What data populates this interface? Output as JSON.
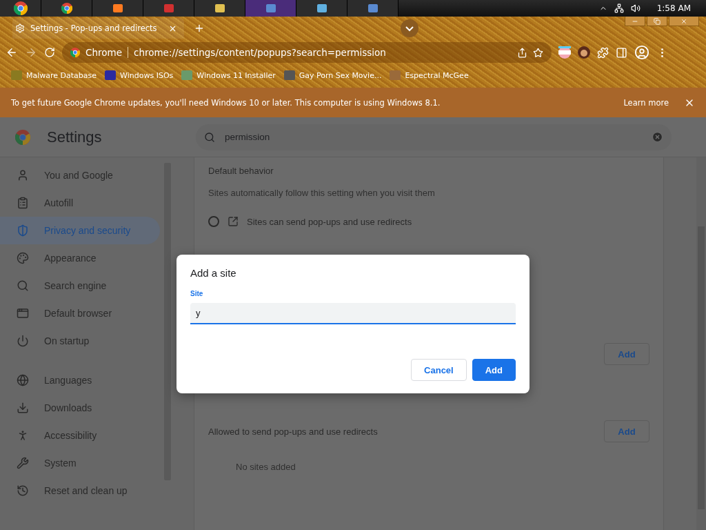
{
  "taskbar": {
    "clock": "1:58 AM"
  },
  "tab": {
    "title": "Settings - Pop-ups and redirects",
    "selected": true
  },
  "address_bar": {
    "site_label": "Chrome",
    "url": "chrome://settings/content/popups?search=permission"
  },
  "bookmarks": [
    {
      "label": "Malware Database"
    },
    {
      "label": "Windows ISOs"
    },
    {
      "label": "Windows 11 Installer"
    },
    {
      "label": "Gay Porn Sex Movie..."
    },
    {
      "label": "Espectral McGee"
    }
  ],
  "infobar": {
    "message": "To get future Google Chrome updates, you'll need Windows 10 or later. This computer is using Windows 8.1.",
    "link": "Learn more"
  },
  "settings": {
    "title": "Settings",
    "search": {
      "value": "permission"
    }
  },
  "sidebar": {
    "items": [
      {
        "label": "You and Google",
        "selected": false
      },
      {
        "label": "Autofill",
        "selected": false
      },
      {
        "label": "Privacy and security",
        "selected": true
      },
      {
        "label": "Appearance",
        "selected": false
      },
      {
        "label": "Search engine",
        "selected": false
      },
      {
        "label": "Default browser",
        "selected": false
      },
      {
        "label": "On startup",
        "selected": false
      },
      {
        "label": "Languages",
        "selected": false
      },
      {
        "label": "Downloads",
        "selected": false
      },
      {
        "label": "Accessibility",
        "selected": false
      },
      {
        "label": "System",
        "selected": false
      },
      {
        "label": "Reset and clean up",
        "selected": false
      }
    ]
  },
  "content": {
    "heading": "Default behavior",
    "description": "Sites automatically follow this setting when you visit them",
    "option": {
      "label": "Sites can send pop-ups and use redirects",
      "selected": false
    },
    "blocked_list": {
      "button": "Add"
    },
    "allowed_list": {
      "title": "Allowed to send pop-ups and use redirects",
      "button": "Add",
      "empty": "No sites added"
    }
  },
  "dialog": {
    "title": "Add a site",
    "field": {
      "label": "Site",
      "value": "y"
    },
    "buttons": [
      "Cancel",
      "Add"
    ]
  }
}
